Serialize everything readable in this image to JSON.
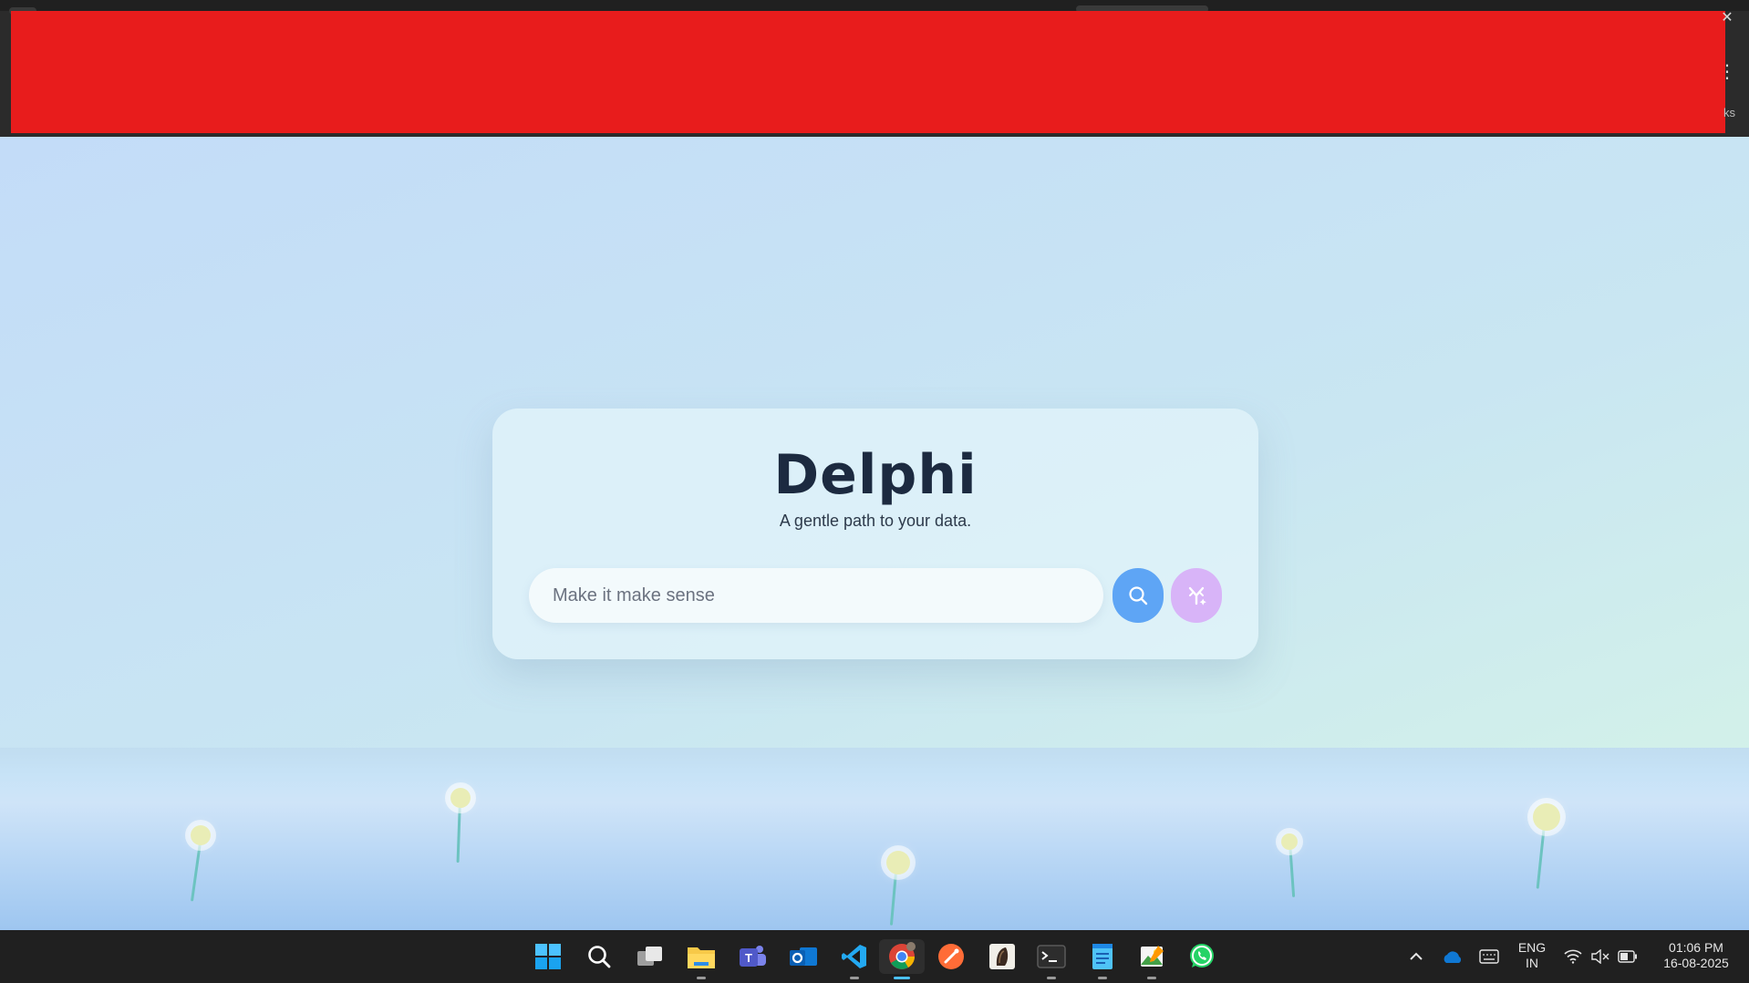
{
  "app": {
    "title": "Delphi",
    "subtitle": "A gentle path to your data."
  },
  "search": {
    "placeholder": "Make it make sense",
    "value": ""
  },
  "colors": {
    "search_button": "#5ea5f5",
    "magic_button": "#d8b4f8",
    "title": "#1c2a40"
  },
  "icons": {
    "search_button_icon": "search-icon",
    "magic_button_icon": "sparkle-wand-icon"
  },
  "browser": {
    "bookmarks_fragment": "ks"
  },
  "taskbar": {
    "apps": [
      {
        "name": "start-icon"
      },
      {
        "name": "taskbar-search-icon"
      },
      {
        "name": "task-view-icon"
      },
      {
        "name": "file-explorer-icon"
      },
      {
        "name": "teams-icon"
      },
      {
        "name": "outlook-icon"
      },
      {
        "name": "vscode-icon"
      },
      {
        "name": "chrome-icon"
      },
      {
        "name": "postman-icon"
      },
      {
        "name": "app-icon"
      },
      {
        "name": "terminal-icon"
      },
      {
        "name": "notepad-icon"
      },
      {
        "name": "image-editor-icon"
      },
      {
        "name": "whatsapp-icon"
      }
    ],
    "tray": {
      "language": "ENG",
      "region": "IN",
      "time": "01:06 PM",
      "date": "16-08-2025"
    }
  }
}
